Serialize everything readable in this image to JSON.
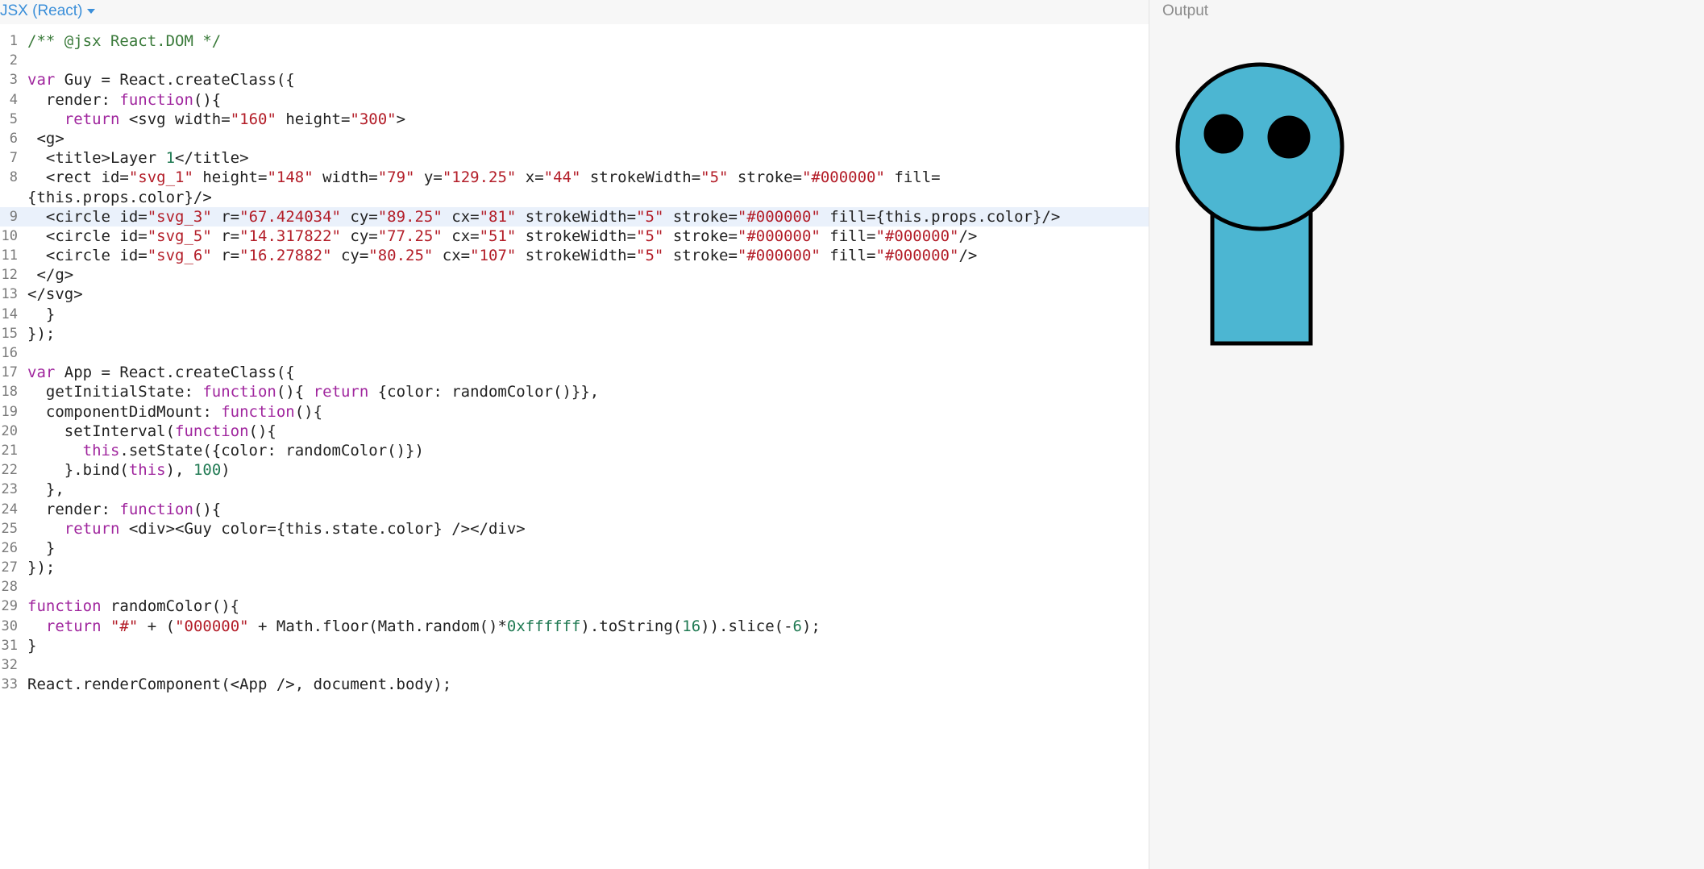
{
  "editor": {
    "language_label": "JSX (React)",
    "active_line": 9,
    "lines": [
      {
        "n": "1",
        "tokens": [
          {
            "t": "/** @jsx React.DOM */",
            "c": "cm"
          }
        ]
      },
      {
        "n": "2",
        "tokens": []
      },
      {
        "n": "3",
        "tokens": [
          {
            "t": "var",
            "c": "kw"
          },
          {
            "t": " Guy = React.createClass({",
            "c": "pl"
          }
        ]
      },
      {
        "n": "4",
        "tokens": [
          {
            "t": "  render: ",
            "c": "pl"
          },
          {
            "t": "function",
            "c": "kw"
          },
          {
            "t": "(){",
            "c": "pl"
          }
        ]
      },
      {
        "n": "5",
        "tokens": [
          {
            "t": "    ",
            "c": "pl"
          },
          {
            "t": "return",
            "c": "kw"
          },
          {
            "t": " <svg width=",
            "c": "pl"
          },
          {
            "t": "\"160\"",
            "c": "str"
          },
          {
            "t": " height=",
            "c": "pl"
          },
          {
            "t": "\"300\"",
            "c": "str"
          },
          {
            "t": ">",
            "c": "pl"
          }
        ]
      },
      {
        "n": "6",
        "tokens": [
          {
            "t": " <g>",
            "c": "pl"
          }
        ]
      },
      {
        "n": "7",
        "tokens": [
          {
            "t": "  <title>Layer ",
            "c": "pl"
          },
          {
            "t": "1",
            "c": "num"
          },
          {
            "t": "</title>",
            "c": "pl"
          }
        ]
      },
      {
        "n": "8",
        "tokens": [
          {
            "t": "  <rect id=",
            "c": "pl"
          },
          {
            "t": "\"svg_1\"",
            "c": "str"
          },
          {
            "t": " height=",
            "c": "pl"
          },
          {
            "t": "\"148\"",
            "c": "str"
          },
          {
            "t": " width=",
            "c": "pl"
          },
          {
            "t": "\"79\"",
            "c": "str"
          },
          {
            "t": " y=",
            "c": "pl"
          },
          {
            "t": "\"129.25\"",
            "c": "str"
          },
          {
            "t": " x=",
            "c": "pl"
          },
          {
            "t": "\"44\"",
            "c": "str"
          },
          {
            "t": " strokeWidth=",
            "c": "pl"
          },
          {
            "t": "\"5\"",
            "c": "str"
          },
          {
            "t": " stroke=",
            "c": "pl"
          },
          {
            "t": "\"#000000\"",
            "c": "str"
          },
          {
            "t": " fill=",
            "c": "pl"
          }
        ]
      },
      {
        "n": "",
        "tokens": [
          {
            "t": "{this.props.color}/>",
            "c": "pl"
          }
        ]
      },
      {
        "n": "9",
        "tokens": [
          {
            "t": "  <circle id=",
            "c": "pl"
          },
          {
            "t": "\"svg_3\"",
            "c": "str"
          },
          {
            "t": " r=",
            "c": "pl"
          },
          {
            "t": "\"67.424034\"",
            "c": "str"
          },
          {
            "t": " cy=",
            "c": "pl"
          },
          {
            "t": "\"89.25\"",
            "c": "str"
          },
          {
            "t": " cx=",
            "c": "pl"
          },
          {
            "t": "\"81\"",
            "c": "str"
          },
          {
            "t": " strokeWidth=",
            "c": "pl"
          },
          {
            "t": "\"5\"",
            "c": "str"
          },
          {
            "t": " stroke=",
            "c": "pl"
          },
          {
            "t": "\"#000000\"",
            "c": "str"
          },
          {
            "t": " fill={this.props.color}/>",
            "c": "pl"
          }
        ]
      },
      {
        "n": "10",
        "tokens": [
          {
            "t": "  <circle id=",
            "c": "pl"
          },
          {
            "t": "\"svg_5\"",
            "c": "str"
          },
          {
            "t": " r=",
            "c": "pl"
          },
          {
            "t": "\"14.317822\"",
            "c": "str"
          },
          {
            "t": " cy=",
            "c": "pl"
          },
          {
            "t": "\"77.25\"",
            "c": "str"
          },
          {
            "t": " cx=",
            "c": "pl"
          },
          {
            "t": "\"51\"",
            "c": "str"
          },
          {
            "t": " strokeWidth=",
            "c": "pl"
          },
          {
            "t": "\"5\"",
            "c": "str"
          },
          {
            "t": " stroke=",
            "c": "pl"
          },
          {
            "t": "\"#000000\"",
            "c": "str"
          },
          {
            "t": " fill=",
            "c": "pl"
          },
          {
            "t": "\"#000000\"",
            "c": "str"
          },
          {
            "t": "/>",
            "c": "pl"
          }
        ]
      },
      {
        "n": "11",
        "tokens": [
          {
            "t": "  <circle id=",
            "c": "pl"
          },
          {
            "t": "\"svg_6\"",
            "c": "str"
          },
          {
            "t": " r=",
            "c": "pl"
          },
          {
            "t": "\"16.27882\"",
            "c": "str"
          },
          {
            "t": " cy=",
            "c": "pl"
          },
          {
            "t": "\"80.25\"",
            "c": "str"
          },
          {
            "t": " cx=",
            "c": "pl"
          },
          {
            "t": "\"107\"",
            "c": "str"
          },
          {
            "t": " strokeWidth=",
            "c": "pl"
          },
          {
            "t": "\"5\"",
            "c": "str"
          },
          {
            "t": " stroke=",
            "c": "pl"
          },
          {
            "t": "\"#000000\"",
            "c": "str"
          },
          {
            "t": " fill=",
            "c": "pl"
          },
          {
            "t": "\"#000000\"",
            "c": "str"
          },
          {
            "t": "/>",
            "c": "pl"
          }
        ]
      },
      {
        "n": "12",
        "tokens": [
          {
            "t": " </g>",
            "c": "pl"
          }
        ]
      },
      {
        "n": "13",
        "tokens": [
          {
            "t": "</svg>",
            "c": "pl"
          }
        ]
      },
      {
        "n": "14",
        "tokens": [
          {
            "t": "  }",
            "c": "pl"
          }
        ]
      },
      {
        "n": "15",
        "tokens": [
          {
            "t": "});",
            "c": "pl"
          }
        ]
      },
      {
        "n": "16",
        "tokens": []
      },
      {
        "n": "17",
        "tokens": [
          {
            "t": "var",
            "c": "kw"
          },
          {
            "t": " App = React.createClass({",
            "c": "pl"
          }
        ]
      },
      {
        "n": "18",
        "tokens": [
          {
            "t": "  getInitialState: ",
            "c": "pl"
          },
          {
            "t": "function",
            "c": "kw"
          },
          {
            "t": "(){ ",
            "c": "pl"
          },
          {
            "t": "return",
            "c": "kw"
          },
          {
            "t": " {color: randomColor()}},",
            "c": "pl"
          }
        ]
      },
      {
        "n": "19",
        "tokens": [
          {
            "t": "  componentDidMount: ",
            "c": "pl"
          },
          {
            "t": "function",
            "c": "kw"
          },
          {
            "t": "(){",
            "c": "pl"
          }
        ]
      },
      {
        "n": "20",
        "tokens": [
          {
            "t": "    setInterval(",
            "c": "pl"
          },
          {
            "t": "function",
            "c": "kw"
          },
          {
            "t": "(){",
            "c": "pl"
          }
        ]
      },
      {
        "n": "21",
        "tokens": [
          {
            "t": "      ",
            "c": "pl"
          },
          {
            "t": "this",
            "c": "kw"
          },
          {
            "t": ".setState({color: randomColor()})",
            "c": "pl"
          }
        ]
      },
      {
        "n": "22",
        "tokens": [
          {
            "t": "    }.bind(",
            "c": "pl"
          },
          {
            "t": "this",
            "c": "kw"
          },
          {
            "t": "), ",
            "c": "pl"
          },
          {
            "t": "100",
            "c": "num"
          },
          {
            "t": ")",
            "c": "pl"
          }
        ]
      },
      {
        "n": "23",
        "tokens": [
          {
            "t": "  },",
            "c": "pl"
          }
        ]
      },
      {
        "n": "24",
        "tokens": [
          {
            "t": "  render: ",
            "c": "pl"
          },
          {
            "t": "function",
            "c": "kw"
          },
          {
            "t": "(){",
            "c": "pl"
          }
        ]
      },
      {
        "n": "25",
        "tokens": [
          {
            "t": "    ",
            "c": "pl"
          },
          {
            "t": "return",
            "c": "kw"
          },
          {
            "t": " <div><Guy color={this.state.color} /></div>",
            "c": "pl"
          }
        ]
      },
      {
        "n": "26",
        "tokens": [
          {
            "t": "  }",
            "c": "pl"
          }
        ]
      },
      {
        "n": "27",
        "tokens": [
          {
            "t": "});",
            "c": "pl"
          }
        ]
      },
      {
        "n": "28",
        "tokens": []
      },
      {
        "n": "29",
        "tokens": [
          {
            "t": "function",
            "c": "kw"
          },
          {
            "t": " randomColor(){",
            "c": "pl"
          }
        ]
      },
      {
        "n": "30",
        "tokens": [
          {
            "t": "  ",
            "c": "pl"
          },
          {
            "t": "return",
            "c": "kw"
          },
          {
            "t": " ",
            "c": "pl"
          },
          {
            "t": "\"#\"",
            "c": "str"
          },
          {
            "t": " + (",
            "c": "pl"
          },
          {
            "t": "\"000000\"",
            "c": "str"
          },
          {
            "t": " + Math.floor(Math.random()*",
            "c": "pl"
          },
          {
            "t": "0xffffff",
            "c": "num"
          },
          {
            "t": ").toString(",
            "c": "pl"
          },
          {
            "t": "16",
            "c": "num"
          },
          {
            "t": ")).slice(-",
            "c": "pl"
          },
          {
            "t": "6",
            "c": "num"
          },
          {
            "t": ");",
            "c": "pl"
          }
        ]
      },
      {
        "n": "31",
        "tokens": [
          {
            "t": "}",
            "c": "pl"
          }
        ]
      },
      {
        "n": "32",
        "tokens": []
      },
      {
        "n": "33",
        "tokens": [
          {
            "t": "React.renderComponent(<App />, document.body);",
            "c": "pl"
          }
        ]
      }
    ]
  },
  "output": {
    "title": "Output",
    "guy": {
      "fill_color": "#4cb6d2",
      "stroke_color": "#000000",
      "eye_color": "#000000"
    }
  }
}
